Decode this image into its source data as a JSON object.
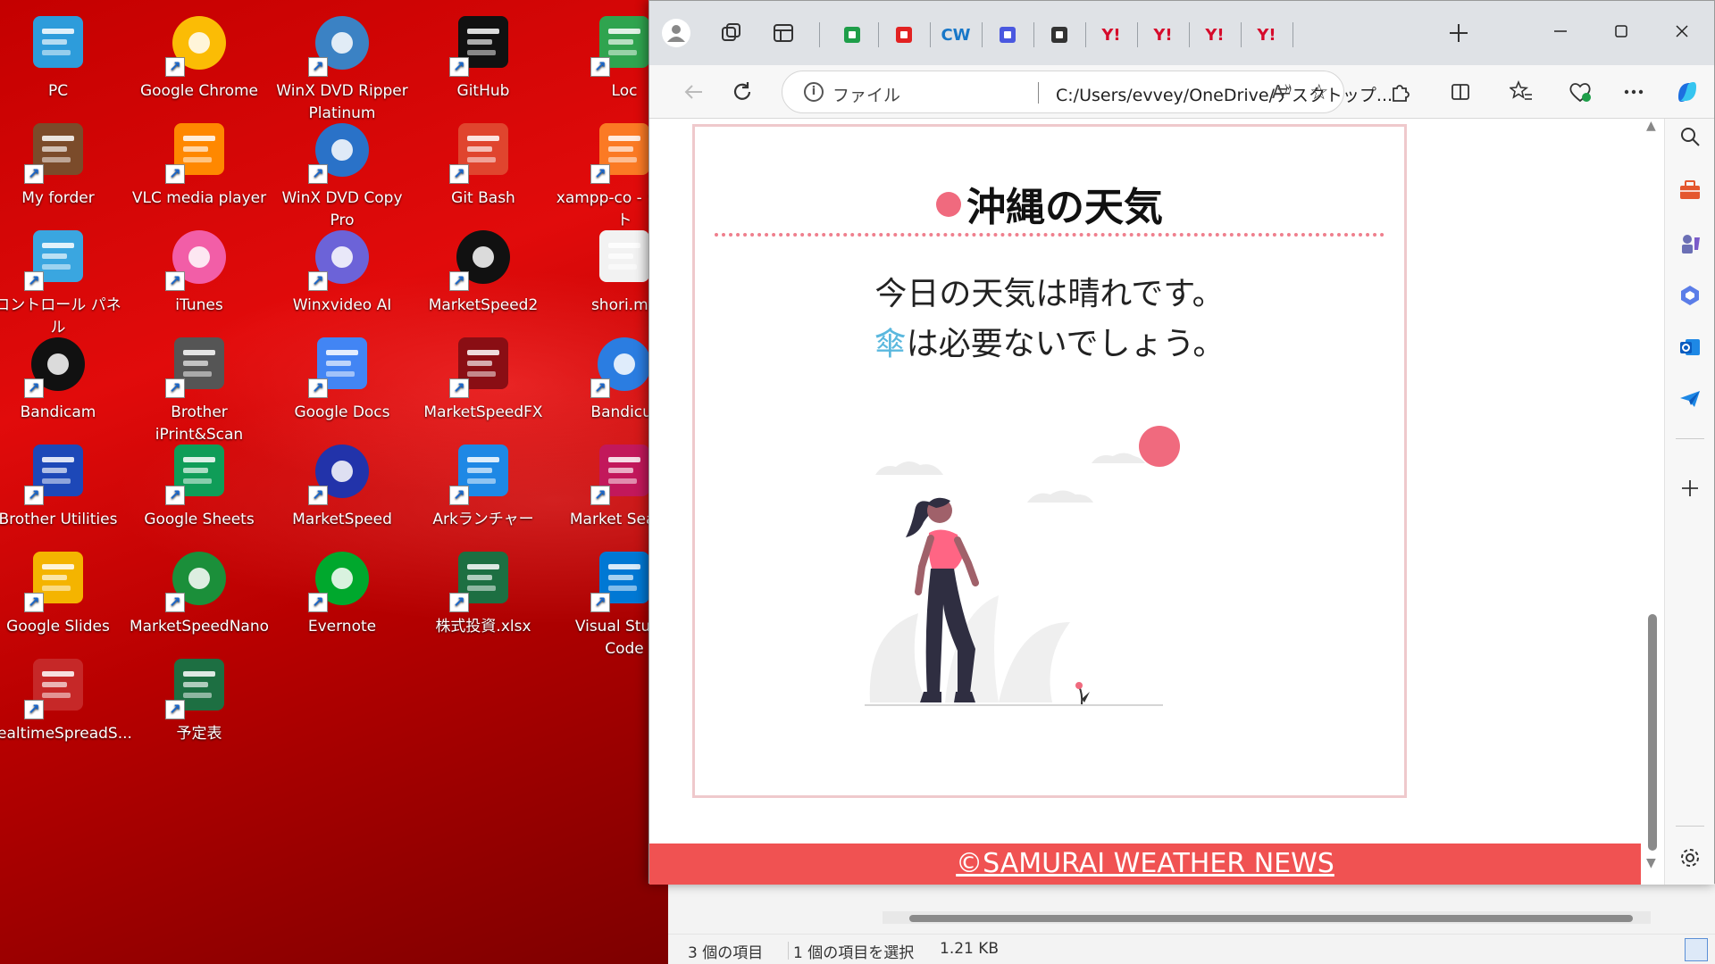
{
  "desktop": {
    "icons": [
      {
        "label": "PC",
        "icon": "monitor-icon"
      },
      {
        "label": "Google Chrome",
        "icon": "chrome-icon"
      },
      {
        "label": "WinX DVD Ripper Platinum",
        "icon": "dvd-ripper-icon"
      },
      {
        "label": "GitHub",
        "icon": "github-icon"
      },
      {
        "label": "Loc",
        "icon": "green-app-icon"
      },
      {
        "label": "My forder",
        "icon": "folder-character-icon"
      },
      {
        "label": "VLC media player",
        "icon": "vlc-icon"
      },
      {
        "label": "WinX DVD Copy Pro",
        "icon": "dvd-copy-icon"
      },
      {
        "label": "Git Bash",
        "icon": "git-bash-icon"
      },
      {
        "label": "xampp-co - ショート",
        "icon": "xampp-icon"
      },
      {
        "label": "コントロール パネル",
        "icon": "control-panel-icon"
      },
      {
        "label": "iTunes",
        "icon": "itunes-icon"
      },
      {
        "label": "Winxvideo AI",
        "icon": "winxvideo-icon"
      },
      {
        "label": "MarketSpeed2",
        "icon": "marketspeed2-icon"
      },
      {
        "label": "shori.mo",
        "icon": "document-icon"
      },
      {
        "label": "Bandicam",
        "icon": "bandicam-icon"
      },
      {
        "label": "Brother iPrint&Scan",
        "icon": "scanner-icon"
      },
      {
        "label": "Google Docs",
        "icon": "google-docs-icon"
      },
      {
        "label": "MarketSpeedFX",
        "icon": "marketspeedfx-icon"
      },
      {
        "label": "Bandicut",
        "icon": "bandicut-icon"
      },
      {
        "label": "Brother Utilities",
        "icon": "brother-utilities-icon"
      },
      {
        "label": "Google Sheets",
        "icon": "google-sheets-icon"
      },
      {
        "label": "MarketSpeed",
        "icon": "marketspeed-icon"
      },
      {
        "label": "Arkランチャー",
        "icon": "ark-launcher-icon"
      },
      {
        "label": "Market Search",
        "icon": "market-search-icon"
      },
      {
        "label": "Google Slides",
        "icon": "google-slides-icon"
      },
      {
        "label": "MarketSpeedNano",
        "icon": "marketspeednano-icon"
      },
      {
        "label": "Evernote",
        "icon": "evernote-icon"
      },
      {
        "label": "株式投資.xlsx",
        "icon": "excel-icon"
      },
      {
        "label": "Visual Studio Code",
        "icon": "vscode-icon"
      },
      {
        "label": "RealtimeSpreadS...",
        "icon": "realtime-spread-icon"
      },
      {
        "label": "予定表",
        "icon": "excel-icon"
      }
    ]
  },
  "browser": {
    "tabs": [
      {
        "icon": "sheets-plus-icon",
        "color": "#1e9e49"
      },
      {
        "icon": "red-swirl-icon",
        "color": "#e22222"
      },
      {
        "icon": "cw-icon",
        "label": "CW",
        "color": "#1877c8"
      },
      {
        "icon": "apple-icon",
        "color": "#4a58e0"
      },
      {
        "icon": "page-icon",
        "color": "#333333"
      },
      {
        "icon": "yahoo-icon",
        "label": "Y!",
        "color": "#d60b2b"
      },
      {
        "icon": "yahoo-icon",
        "label": "Y!",
        "color": "#d60b2b"
      },
      {
        "icon": "yahoo-icon",
        "label": "Y!",
        "color": "#d60b2b"
      },
      {
        "icon": "yahoo-icon",
        "label": "Y!",
        "color": "#d60b2b"
      }
    ],
    "address": {
      "scheme_label": "ファイル",
      "url": "C:/Users/evvey/OneDrive/デスクトップ..."
    }
  },
  "page": {
    "title": "沖縄の天気",
    "message_line1": "今日の天気は晴れです。",
    "message_umbrella": "傘",
    "message_line2_rest": "は必要ないでしょう。",
    "footer": "©SAMURAI WEATHER NEWS",
    "colors": {
      "accent": "#f06a7e",
      "footer_bg": "#f05252",
      "umbrella": "#5ab8de",
      "card_border": "#efc9cc"
    }
  },
  "explorer": {
    "item_count": "3 個の項目",
    "selection": "1 個の項目を選択",
    "size": "1.21 KB"
  }
}
